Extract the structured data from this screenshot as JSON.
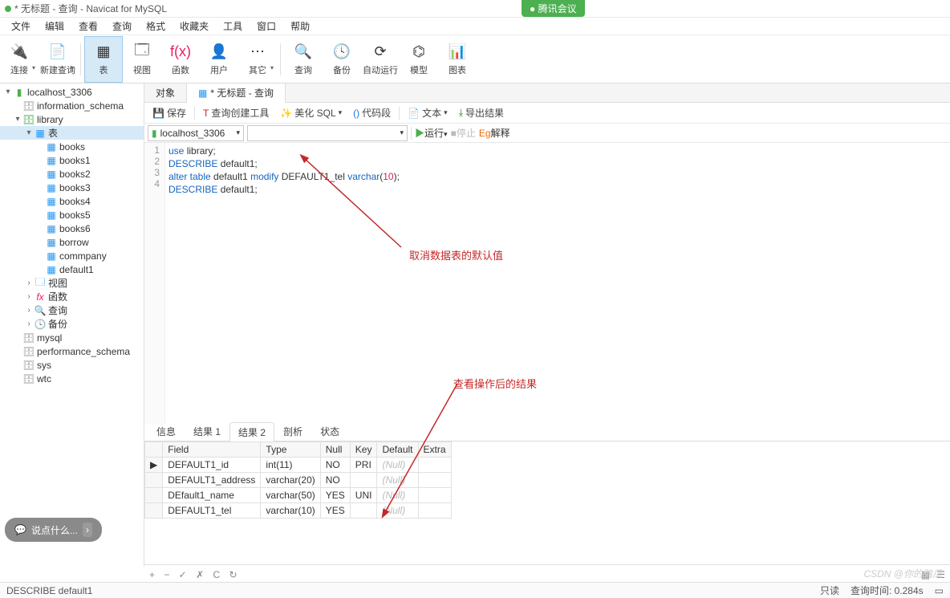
{
  "window": {
    "title": "* 无标题 - 查询 - Navicat for MySQL",
    "meeting_badge": "腾讯会议"
  },
  "menu": [
    "文件",
    "编辑",
    "查看",
    "查询",
    "格式",
    "收藏夹",
    "工具",
    "窗口",
    "帮助"
  ],
  "ribbon": [
    {
      "label": "连接",
      "icon": "🔌"
    },
    {
      "label": "新建查询",
      "icon": "📄"
    },
    {
      "label": "表",
      "icon": "▦",
      "active": true
    },
    {
      "label": "视图",
      "icon": "🗔"
    },
    {
      "label": "函数",
      "icon": "f(x)",
      "color": "#e91e63"
    },
    {
      "label": "用户",
      "icon": "👤"
    },
    {
      "label": "其它",
      "icon": "⋯"
    },
    {
      "label": "查询",
      "icon": "🔍"
    },
    {
      "label": "备份",
      "icon": "🕓"
    },
    {
      "label": "自动运行",
      "icon": "⟳"
    },
    {
      "label": "模型",
      "icon": "⌬"
    },
    {
      "label": "图表",
      "icon": "📊"
    }
  ],
  "tree": {
    "conn": "localhost_3306",
    "dbs": [
      {
        "name": "information_schema"
      },
      {
        "name": "library",
        "open": true,
        "children": [
          {
            "name": "表",
            "open": true,
            "type": "folder",
            "tables": [
              "books",
              "books1",
              "books2",
              "books3",
              "books4",
              "books5",
              "books6",
              "borrow",
              "commpany",
              "default1"
            ]
          },
          {
            "name": "视图",
            "type": "view"
          },
          {
            "name": "函数",
            "type": "fx"
          },
          {
            "name": "查询",
            "type": "query"
          },
          {
            "name": "备份",
            "type": "backup"
          }
        ]
      },
      {
        "name": "mysql"
      },
      {
        "name": "performance_schema"
      },
      {
        "name": "sys"
      },
      {
        "name": "wtc"
      }
    ]
  },
  "tabs": {
    "obj": "对象",
    "query": "* 无标题 - 查询"
  },
  "toolbar2": {
    "save": "保存",
    "builder": "查询创建工具",
    "beautify": "美化 SQL",
    "snippet": "代码段",
    "text": "文本",
    "export": "导出结果"
  },
  "connbar": {
    "conn": "localhost_3306",
    "db": "",
    "run": "运行",
    "stop": "停止",
    "explain": "解释"
  },
  "sql": {
    "lines": [
      {
        "n": 1,
        "raw": "use library;",
        "parts": [
          {
            "t": "use",
            "c": "kw"
          },
          {
            "t": " library;",
            "c": ""
          }
        ]
      },
      {
        "n": 2,
        "raw": "DESCRIBE default1;",
        "parts": [
          {
            "t": "DESCRIBE",
            "c": "kw"
          },
          {
            "t": " default1;",
            "c": ""
          }
        ]
      },
      {
        "n": 3,
        "raw": "alter table default1 modify DEFAULT1_tel varchar(10);",
        "parts": [
          {
            "t": "alter table",
            "c": "kw"
          },
          {
            "t": " default1 ",
            "c": ""
          },
          {
            "t": "modify",
            "c": "kw"
          },
          {
            "t": " DEFAULT1_tel ",
            "c": ""
          },
          {
            "t": "varchar",
            "c": "kw"
          },
          {
            "t": "(",
            "c": ""
          },
          {
            "t": "10",
            "c": "num"
          },
          {
            "t": ");",
            "c": ""
          }
        ]
      },
      {
        "n": 4,
        "raw": "DESCRIBE default1;",
        "parts": [
          {
            "t": "DESCRIBE",
            "c": "kw"
          },
          {
            "t": " default1;",
            "c": ""
          }
        ]
      }
    ]
  },
  "annotations": {
    "a1": "取消数据表的默认值",
    "a2": "查看操作后的结果"
  },
  "result_tabs": [
    "信息",
    "结果 1",
    "结果 2",
    "剖析",
    "状态"
  ],
  "result_active": 2,
  "grid": {
    "cols": [
      "Field",
      "Type",
      "Null",
      "Key",
      "Default",
      "Extra"
    ],
    "rows": [
      {
        "ptr": "▶",
        "Field": "DEFAULT1_id",
        "Type": "int(11)",
        "Null": "NO",
        "Key": "PRI",
        "Default": "(Null)",
        "Extra": ""
      },
      {
        "ptr": "",
        "Field": "DEFAULT1_address",
        "Type": "varchar(20)",
        "Null": "NO",
        "Key": "",
        "Default": "(Null)",
        "Extra": ""
      },
      {
        "ptr": "",
        "Field": "DEfault1_name",
        "Type": "varchar(50)",
        "Null": "YES",
        "Key": "UNI",
        "Default": "(Null)",
        "Extra": ""
      },
      {
        "ptr": "",
        "Field": "DEFAULT1_tel",
        "Type": "varchar(10)",
        "Null": "YES",
        "Key": "",
        "Default": "(Null)",
        "Extra": ""
      }
    ]
  },
  "gridfoot": {
    "icons": "+  −  ✓  ✗   C   ↻"
  },
  "status": {
    "left": "DESCRIBE default1",
    "readonly": "只读",
    "time": "查询时间: 0.284s"
  },
  "chat": "说点什么...",
  "watermark": "CSDN @你的脑瓜"
}
